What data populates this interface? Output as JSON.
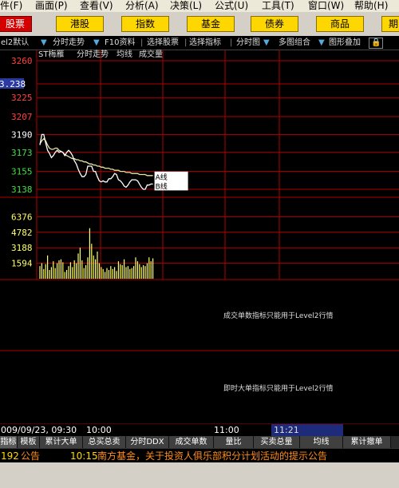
{
  "menu": [
    {
      "label": "件(F)"
    },
    {
      "label": "画面(P)"
    },
    {
      "label": "查看(V)"
    },
    {
      "label": "分析(A)"
    },
    {
      "label": "决策(L)"
    },
    {
      "label": "公式(U)"
    },
    {
      "label": "工具(T)"
    },
    {
      "label": "窗口(W)"
    },
    {
      "label": "帮助(H)"
    }
  ],
  "top_buttons": [
    {
      "label": "股票",
      "active": true
    },
    {
      "label": "港股",
      "active": false
    },
    {
      "label": "指数",
      "active": false
    },
    {
      "label": "基金",
      "active": false
    },
    {
      "label": "债券",
      "active": false
    },
    {
      "label": "商品",
      "active": false
    },
    {
      "label": "期",
      "active": false
    }
  ],
  "toolbar": {
    "level2": "el2默认",
    "intraday": "分时走势",
    "f10": "F10资料",
    "select_stock": "选择股票",
    "select_indicator": "选择指标",
    "intraday_chart": "分时图",
    "multi_combo": "多图组合",
    "overlay": "图形叠加"
  },
  "chart_info": {
    "stock_name": "ST梅雁",
    "mode": "分时走势",
    "avg_line": "均线",
    "volume": "成交量"
  },
  "chart_data": {
    "type": "line",
    "price_ticks": [
      "3260",
      "3238",
      "3225",
      "3207",
      "3190",
      "3173",
      "3155",
      "3138"
    ],
    "price_tick_values": [
      3260,
      3238,
      3225,
      3207,
      3190,
      3173,
      3155,
      3138
    ],
    "ylim": [
      3138,
      3260
    ],
    "volume_ticks": [
      "6376",
      "4782",
      "3188",
      "1594"
    ],
    "volume_tick_values": [
      6376,
      4782,
      3188,
      1594
    ],
    "volume_lim": [
      0,
      7970
    ],
    "series": [
      {
        "name": "A线",
        "values": [
          3181,
          3184,
          3186,
          3184,
          3180,
          3177,
          3176,
          3176,
          3177,
          3177,
          3175,
          3174,
          3173,
          3171,
          3170,
          3169,
          3168,
          3167,
          3167,
          3166,
          3166,
          3165,
          3165,
          3164,
          3164,
          3163,
          3162,
          3162,
          3161,
          3161,
          3160,
          3160,
          3159,
          3159,
          3158,
          3158,
          3158,
          3157,
          3157,
          3156,
          3156,
          3156,
          3155,
          3155,
          3155,
          3154,
          3154,
          3154,
          3153,
          3153,
          3153,
          3153,
          3152,
          3152,
          3152,
          3152,
          3151,
          3151,
          3151,
          3151
        ]
      },
      {
        "name": "B线",
        "values": [
          3180,
          3190,
          3190,
          3182,
          3175,
          3172,
          3168,
          3170,
          3173,
          3175,
          3173,
          3174,
          3173,
          3170,
          3173,
          3175,
          3173,
          3170,
          3165,
          3162,
          3157,
          3153,
          3150,
          3150,
          3152,
          3160,
          3160,
          3160,
          3155,
          3155,
          3150,
          3146,
          3145,
          3146,
          3145,
          3145,
          3148,
          3148,
          3150,
          3153,
          3152,
          3147,
          3146,
          3144,
          3141,
          3140,
          3142,
          3145,
          3147,
          3147,
          3147,
          3146,
          3143,
          3140,
          3138,
          3138,
          3142,
          3142,
          3143,
          3143
        ]
      }
    ],
    "volume": [
      1300,
      1600,
      1000,
      1500,
      2400,
      900,
      1200,
      1800,
      1100,
      1600,
      1900,
      2000,
      1700,
      700,
      900,
      1300,
      1700,
      1200,
      1900,
      1600,
      2600,
      3200,
      1900,
      1100,
      1400,
      2200,
      5200,
      3600,
      2400,
      2000,
      2800,
      1600,
      1200,
      1000,
      700,
      1100,
      900,
      1300,
      1000,
      1200,
      800,
      1800,
      1500,
      1400,
      2000,
      1200,
      1300,
      1000,
      1100,
      1300,
      2200,
      1800,
      1500,
      1200,
      1400,
      1300,
      1600,
      2200,
      1800,
      2100
    ],
    "label_a": "A线",
    "label_b": "B线"
  },
  "panels": {
    "level2_msg_1": "成交单数指标只能用于Level2行情",
    "level2_msg_2": "即时大单指标只能用于Level2行情"
  },
  "timebar": {
    "datetime": "009/09/23, 09:30",
    "t1000": "10:00",
    "t1100": "11:00",
    "t1121": "11:21"
  },
  "tabs": [
    {
      "label": "指标",
      "active": true
    },
    {
      "label": "模板",
      "active": false
    },
    {
      "label": "累计大单",
      "active": false
    },
    {
      "label": "总买总卖",
      "active": false
    },
    {
      "label": "分时DDX",
      "active": false
    },
    {
      "label": "成交单数",
      "active": false
    },
    {
      "label": "量比",
      "active": false
    },
    {
      "label": "买卖总量",
      "active": false
    },
    {
      "label": "均线",
      "active": false
    },
    {
      "label": "累计撤单",
      "active": false
    }
  ],
  "ticker": {
    "code": "192",
    "category": "公告",
    "time": "10:15",
    "text": "南方基金，关于投资人俱乐部积分计划活动的提示公告"
  },
  "colors": {
    "red_grid": "#b00000",
    "price_up": "#ff4040",
    "price_down": "#40e040",
    "avg_line": "#ffff66",
    "yellow_button": "#ffd700"
  }
}
